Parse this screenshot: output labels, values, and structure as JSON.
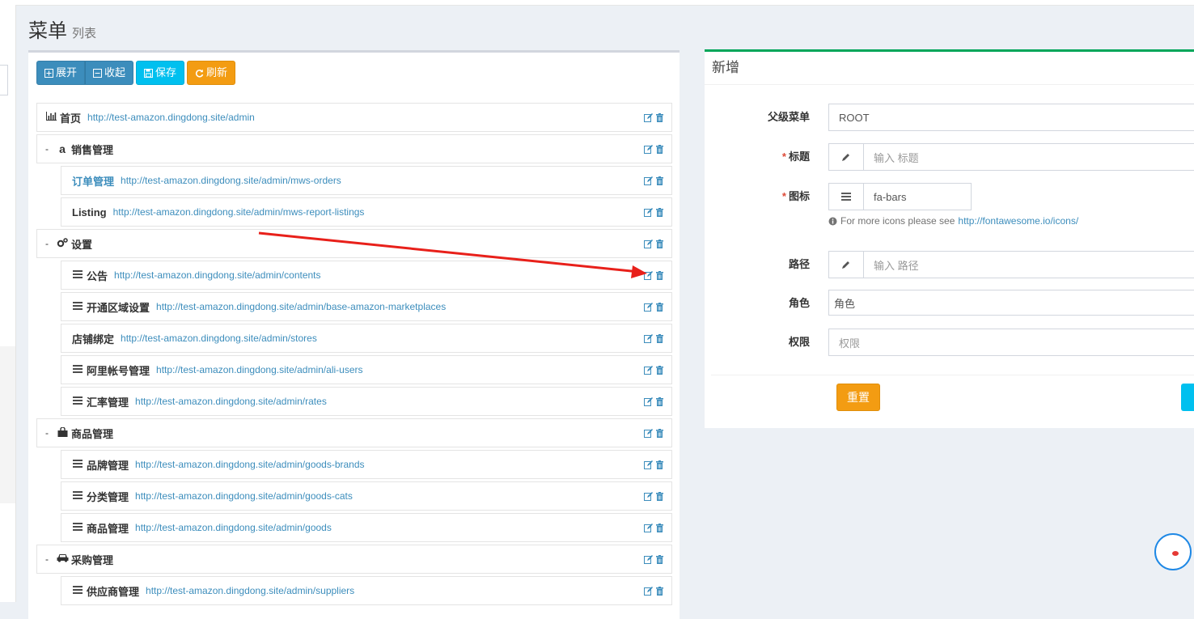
{
  "page": {
    "title": "菜单",
    "subtitle": "列表"
  },
  "toolbar": {
    "expand": "展开",
    "collapse": "收起",
    "save": "保存",
    "refresh": "刷新"
  },
  "tree": [
    {
      "title": "首页",
      "uri": "http://test-amazon.dingdong.site/admin",
      "icon": "bar-chart-icon",
      "level": 0,
      "collapse": ""
    },
    {
      "title": "销售管理",
      "uri": "",
      "icon": "amazon-icon",
      "level": 0,
      "collapse": "-"
    },
    {
      "title": "订单管理",
      "uri": "http://test-amazon.dingdong.site/admin/mws-orders",
      "icon": "",
      "level": 1,
      "link": true
    },
    {
      "title": "Listing",
      "uri": "http://test-amazon.dingdong.site/admin/mws-report-listings",
      "icon": "",
      "level": 1
    },
    {
      "title": "设置",
      "uri": "",
      "icon": "cogs-icon",
      "level": 0,
      "collapse": "-"
    },
    {
      "title": "公告",
      "uri": "http://test-amazon.dingdong.site/admin/contents",
      "icon": "bars-icon",
      "level": 1
    },
    {
      "title": "开通区域设置",
      "uri": "http://test-amazon.dingdong.site/admin/base-amazon-marketplaces",
      "icon": "bars-icon",
      "level": 1
    },
    {
      "title": "店铺绑定",
      "uri": "http://test-amazon.dingdong.site/admin/stores",
      "icon": "",
      "level": 1
    },
    {
      "title": "阿里帐号管理",
      "uri": "http://test-amazon.dingdong.site/admin/ali-users",
      "icon": "bars-icon",
      "level": 1
    },
    {
      "title": "汇率管理",
      "uri": "http://test-amazon.dingdong.site/admin/rates",
      "icon": "bars-icon",
      "level": 1
    },
    {
      "title": "商品管理",
      "uri": "",
      "icon": "shopping-bag-icon",
      "level": 0,
      "collapse": "-"
    },
    {
      "title": "品牌管理",
      "uri": "http://test-amazon.dingdong.site/admin/goods-brands",
      "icon": "bars-icon",
      "level": 1
    },
    {
      "title": "分类管理",
      "uri": "http://test-amazon.dingdong.site/admin/goods-cats",
      "icon": "bars-icon",
      "level": 1
    },
    {
      "title": "商品管理",
      "uri": "http://test-amazon.dingdong.site/admin/goods",
      "icon": "bars-icon",
      "level": 1
    },
    {
      "title": "采购管理",
      "uri": "",
      "icon": "car-icon",
      "level": 0,
      "collapse": "-"
    },
    {
      "title": "供应商管理",
      "uri": "http://test-amazon.dingdong.site/admin/suppliers",
      "icon": "bars-icon",
      "level": 1
    }
  ],
  "form": {
    "header": "新增",
    "parent": {
      "label": "父级菜单",
      "value": "ROOT"
    },
    "title": {
      "label": "标题",
      "placeholder": "输入 标题"
    },
    "icon": {
      "label": "图标",
      "value": "fa-bars",
      "help": "For more icons please see",
      "help_link": "http://fontawesome.io/icons/"
    },
    "uri": {
      "label": "路径",
      "placeholder": "输入 路径"
    },
    "roles": {
      "label": "角色",
      "placeholder": "角色"
    },
    "permission": {
      "label": "权限",
      "placeholder": "权限"
    },
    "reset": "重置"
  },
  "colors": {
    "primary": "#3c8dbc",
    "info": "#00c0ef",
    "warning": "#f39c12",
    "success": "#00a65a",
    "danger": "#dd4b39"
  }
}
